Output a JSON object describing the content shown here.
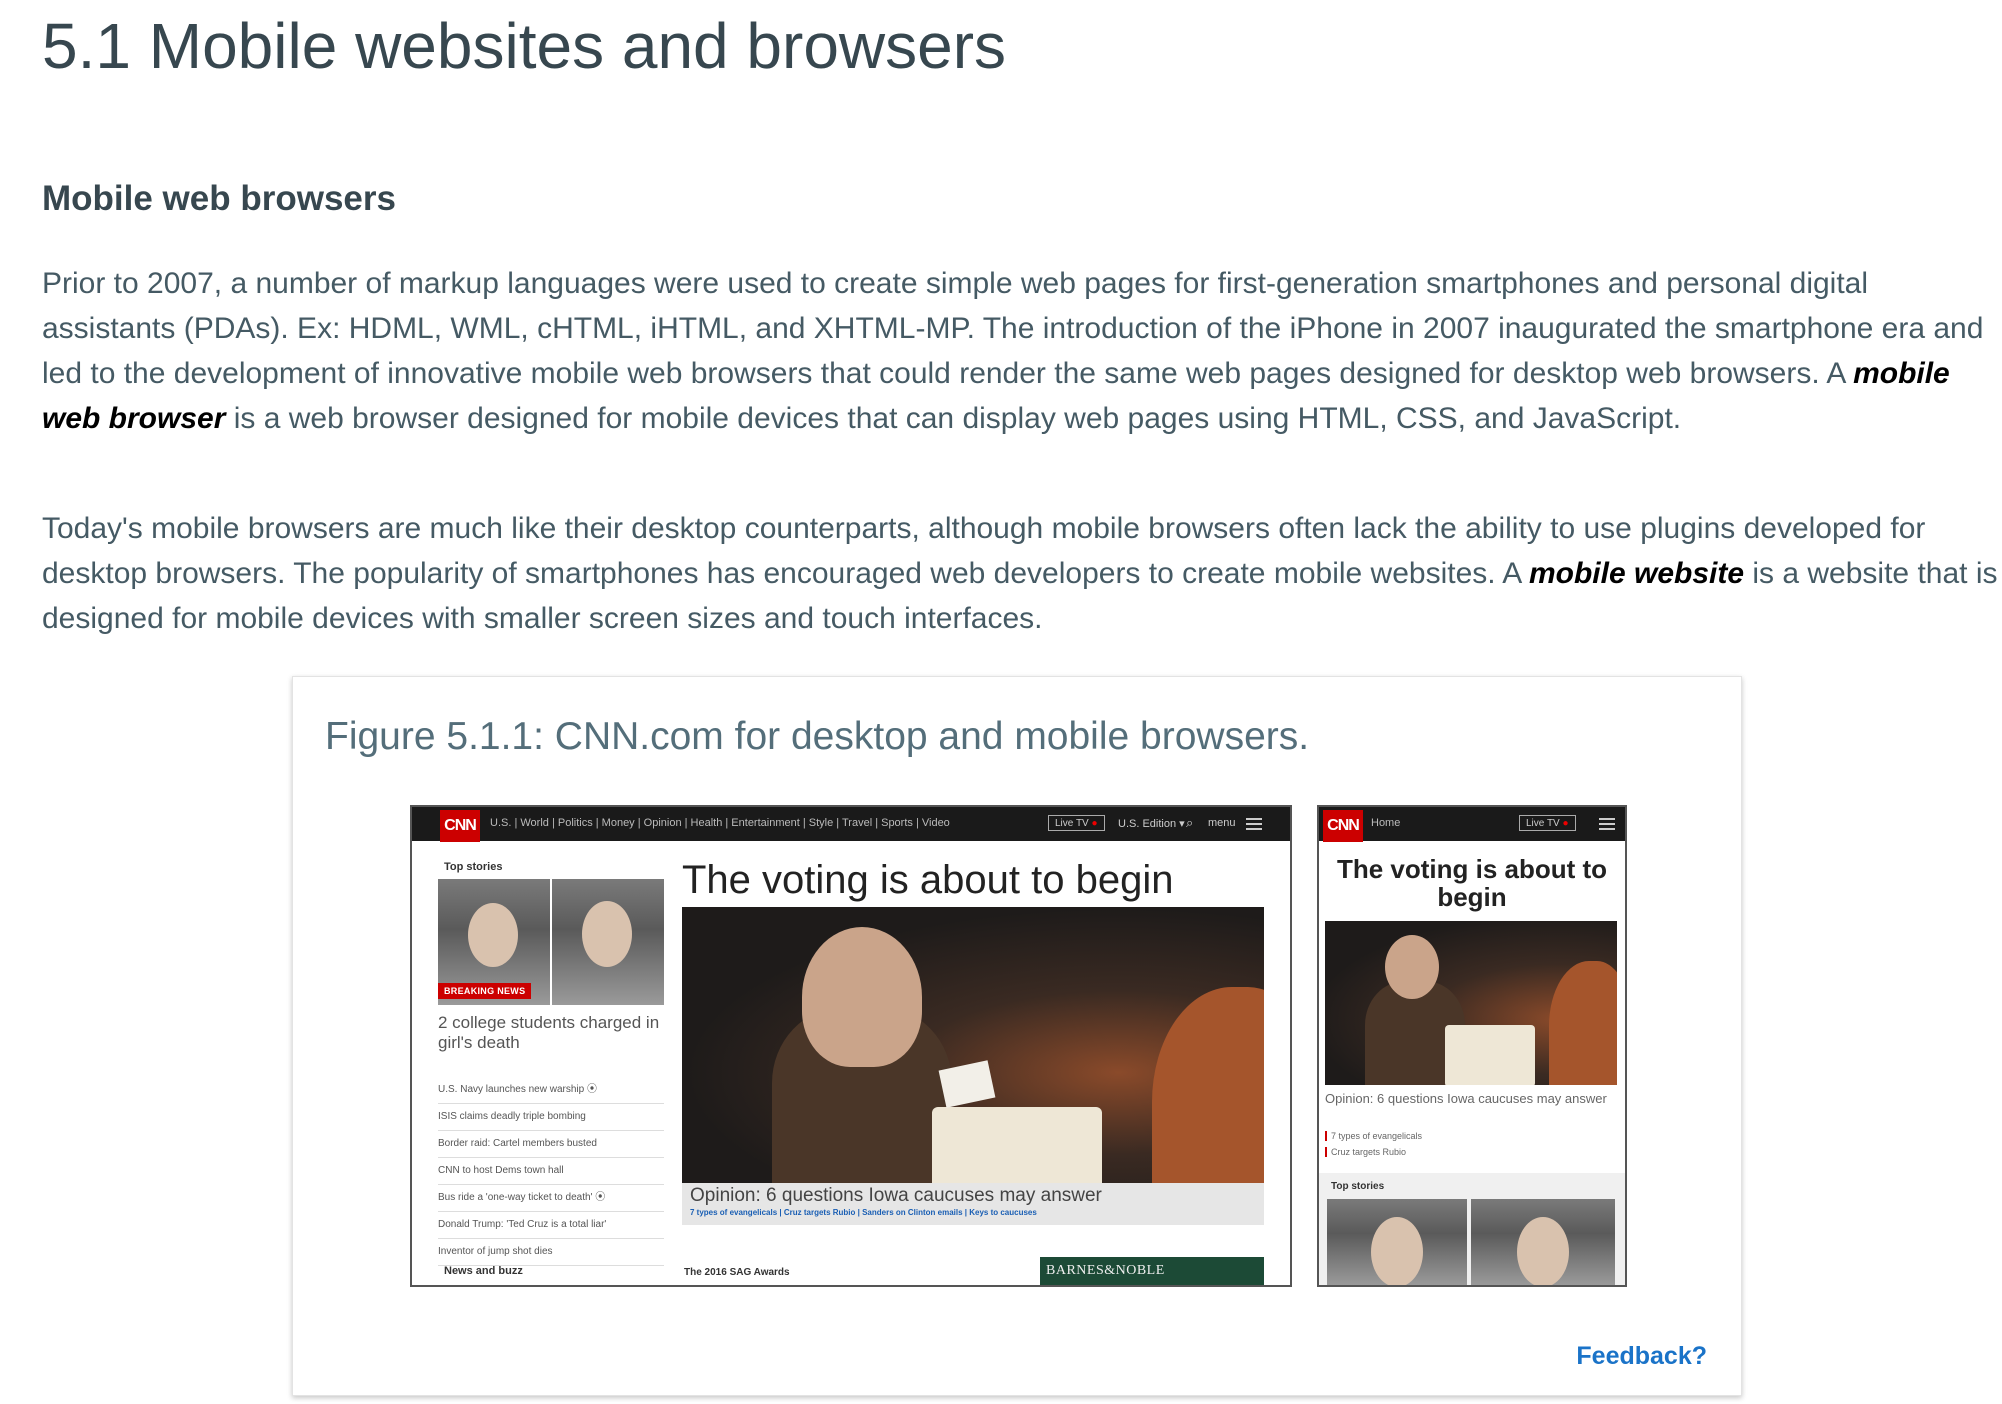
{
  "page": {
    "title": "5.1 Mobile websites and browsers",
    "section_heading": "Mobile web browsers",
    "p1_before": "Prior to 2007, a number of markup languages were used to create simple web pages for first-generation smartphones and personal digital assistants (PDAs). Ex: HDML, WML, cHTML, iHTML, and XHTML-MP. The introduction of the iPhone in 2007 inaugurated the smartphone era and led to the development of innovative mobile web browsers that could render the same web pages designed for desktop web browsers. A ",
    "p1_term": "mobile web browser",
    "p1_after": " is a web browser designed for mobile devices that can display web pages using HTML, CSS, and JavaScript.",
    "p2_before": "Today's mobile browsers are much like their desktop counterparts, although mobile browsers often lack the ability to use plugins developed for desktop browsers. The popularity of smartphones has encouraged web developers to create mobile websites. A ",
    "p2_term": "mobile website",
    "p2_after": " is a website that is designed for mobile devices with smaller screen sizes and touch interfaces."
  },
  "figure": {
    "caption": "Figure 5.1.1: CNN.com for desktop and mobile browsers.",
    "feedback": "Feedback?"
  },
  "desktop": {
    "logo": "CNN",
    "nav": "U.S. | World | Politics | Money | Opinion | Health | Entertainment | Style | Travel | Sports | Video",
    "live_tv": "Live TV",
    "edition": "U.S. Edition ▾",
    "menu": "menu",
    "top_stories": "Top stories",
    "breaking": "BREAKING NEWS",
    "lead_story": "2 college students charged in girl's death",
    "stories": [
      "U.S. Navy launches new warship ⦿",
      "ISIS claims deadly triple bombing",
      "Border raid: Cartel members busted",
      "CNN to host Dems town hall",
      "Bus ride a 'one-way ticket to death' ⦿",
      "Donald Trump: 'Ted Cruz is a total liar'",
      "Inventor of jump shot dies"
    ],
    "news_and_buzz": "News and buzz",
    "headline": "The voting is about to begin",
    "hero_caption": "Opinion: 6 questions Iowa caucuses may answer",
    "hero_links": "7 types of evangelicals | Cruz targets Rubio | Sanders on Clinton emails | Keys to caucuses",
    "sag": "The 2016 SAG Awards",
    "ad": "BARNES&NOBLE"
  },
  "mobile": {
    "logo": "CNN",
    "home": "Home",
    "live_tv": "Live TV",
    "headline": "The voting is about to begin",
    "opinion": "Opinion: 6 questions Iowa caucuses may answer",
    "link1": "7 types of evangelicals",
    "link2": "Cruz targets Rubio",
    "top_stories": "Top stories"
  }
}
